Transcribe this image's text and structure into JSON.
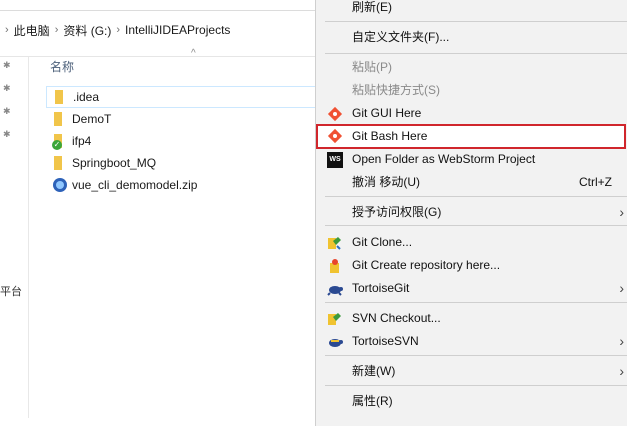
{
  "explorer": {
    "breadcrumbs": [
      "此电脑",
      "资料 (G:)",
      "IntelliJIDEAProjects"
    ],
    "column_header": "名称",
    "nav_cut_text": "平台",
    "files": [
      {
        "name": ".idea",
        "icon": "folder-icon"
      },
      {
        "name": "DemoT",
        "icon": "folder-icon"
      },
      {
        "name": "ifp4",
        "icon": "folder-synced-icon"
      },
      {
        "name": "Springboot_MQ",
        "icon": "folder-icon"
      },
      {
        "name": "vue_cli_demomodel.zip",
        "icon": "zip-file-icon"
      }
    ]
  },
  "context_menu": {
    "items": [
      {
        "label": "刷新(E)"
      },
      {
        "label": "自定义文件夹(F)..."
      },
      {
        "label": "粘贴(P)",
        "disabled": true
      },
      {
        "label": "粘贴快捷方式(S)",
        "disabled": true
      },
      {
        "label": "Git GUI Here",
        "icon": "git-icon"
      },
      {
        "label": "Git Bash Here",
        "icon": "git-icon",
        "highlighted": true
      },
      {
        "label": "Open Folder as WebStorm Project",
        "icon": "webstorm-icon"
      },
      {
        "label": "撤消 移动(U)",
        "shortcut": "Ctrl+Z"
      },
      {
        "label": "授予访问权限(G)",
        "submenu": true
      },
      {
        "label": "Git Clone...",
        "icon": "tortoisegit-clone-icon"
      },
      {
        "label": "Git Create repository here...",
        "icon": "tortoisegit-create-repo-icon"
      },
      {
        "label": "TortoiseGit",
        "icon": "tortoisegit-icon",
        "submenu": true
      },
      {
        "label": "SVN Checkout...",
        "icon": "svn-checkout-icon"
      },
      {
        "label": "TortoiseSVN",
        "icon": "tortoisesvn-icon",
        "submenu": true
      },
      {
        "label": "新建(W)",
        "submenu": true
      },
      {
        "label": "属性(R)"
      }
    ],
    "webstorm_badge": "WS"
  },
  "colors": {
    "highlight_border": "#d0262c",
    "menu_bg": "#f2f2f2",
    "git_orange": "#f05133",
    "folder_yellow": "#f3c446"
  }
}
